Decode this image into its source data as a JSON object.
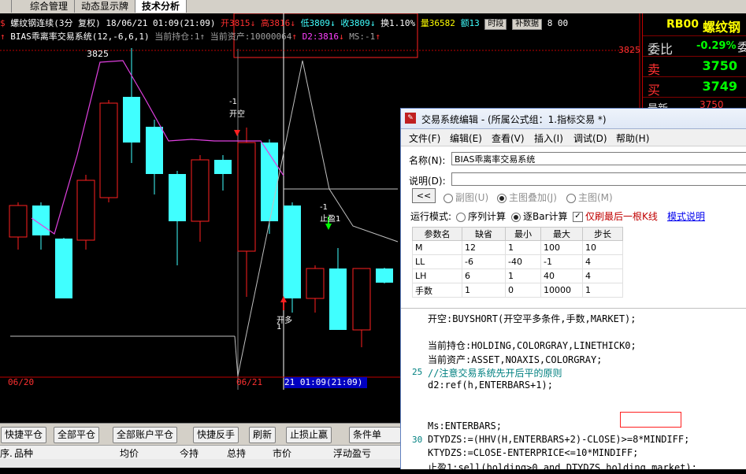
{
  "tabs": [
    {
      "label": "综合管理"
    },
    {
      "label": "动态显示牌"
    },
    {
      "label": "技术分析"
    }
  ],
  "quote_line": {
    "symbol": "螺纹钢连续(3分 复权) 18/06/21 01:09(21:09)",
    "open": "开3815",
    "high": "高3816",
    "low": "低3809",
    "close": "收3809",
    "change": "换1.10%",
    "volume": "量36582",
    "amount": "额13",
    "btn_timesection": "时段",
    "btn_fillin": "补数据",
    "tail": "8 00"
  },
  "indicator_line": {
    "name": "BIAS乖离率交易系统(12,-6,6,1)",
    "holding": "当前持仓:1",
    "asset": "当前资产:10000064",
    "d2": "D2:3816",
    "ms": "MS:-1"
  },
  "chart": {
    "high_label": "3825",
    "price_tag": "3825",
    "signal_open_short": [
      "-1",
      "开空"
    ],
    "signal_stop_gain": [
      "-1",
      "止盈1"
    ],
    "signal_close": [
      "开多",
      "1"
    ],
    "date_left": "06/20",
    "date_mid": "06/21",
    "date_cursor": "21 01:09(21:09)"
  },
  "right_panel": {
    "code": "RB00",
    "name": "螺纹钢",
    "weibi_label": "委比",
    "weibi_value": "-0.29%",
    "weibi_tail": "委",
    "sell_label": "卖",
    "sell_value": "3750",
    "buy_label": "买",
    "buy_value": "3749",
    "latest_label": "最新",
    "latest_value": "3750"
  },
  "editor": {
    "title": "交易系统编辑 - (所属公式组：1.指标交易 *)",
    "menu": [
      "文件(F)",
      "编辑(E)",
      "查看(V)",
      "插入(I)",
      "调试(D)",
      "帮助(H)"
    ],
    "name_label": "名称(N):",
    "name_value": "BIAS乖离率交易系统",
    "desc_label": "说明(D):",
    "desc_value": "",
    "collapse_btn": "<<",
    "radio_sub": "副图(U)",
    "radio_overlay": "主图叠加(J)",
    "radio_main": "主图(M)",
    "mode_label": "运行模式:",
    "mode_seq": "序列计算",
    "mode_tick": "逐Bar计算",
    "only_last": "仅刷最后一根K线",
    "model_help": "模式说明",
    "param_headers": [
      "参数名",
      "缺省",
      "最小",
      "最大",
      "步长"
    ],
    "params": [
      [
        "M",
        "12",
        "1",
        "100",
        "10"
      ],
      [
        "LL",
        "-6",
        "-40",
        "-1",
        "4"
      ],
      [
        "LH",
        "6",
        "1",
        "40",
        "4"
      ],
      [
        "手数",
        "1",
        "0",
        "10000",
        "1"
      ]
    ],
    "code_lines": [
      {
        "n": "",
        "t": "开空:BUYSHORT(开空平多条件,手数,MARKET);"
      },
      {
        "n": "",
        "t": ""
      },
      {
        "n": "",
        "t": "当前持仓:HOLDING,COLORGRAY,LINETHICK0;"
      },
      {
        "n": "",
        "t": "当前资产:ASSET,NOAXIS,COLORGRAY;"
      },
      {
        "n": "25",
        "t": "//注意交易系统先开后平的原则"
      },
      {
        "n": "",
        "t": "d2:ref(h,ENTERBARS+1);"
      },
      {
        "n": "",
        "t": ""
      },
      {
        "n": "",
        "t": ""
      },
      {
        "n": "",
        "t": "Ms:ENTERBARS;"
      },
      {
        "n": "30",
        "t": "DTYDZS:=(HHV(H,ENTERBARS+2)-CLOSE)>=8*MINDIFF;"
      },
      {
        "n": "",
        "t": "KTYDZS:=CLOSE-ENTERPRICE<=10*MINDIFF;"
      },
      {
        "n": "",
        "t": "止盈1:sell(holding>0 and DTYDZS,holding,market);"
      }
    ]
  },
  "bottom_buttons": [
    "快捷平仓",
    "全部平仓",
    "全部账户平仓",
    "快捷反手",
    "刷新",
    "止损止赢",
    "条件单"
  ],
  "table_columns": [
    "序.",
    "品种",
    "均价",
    "今持",
    "总持",
    "市价",
    "浮动盈亏"
  ],
  "colors": {
    "up_candle": "#ff2020",
    "down_candle": "#40ffff",
    "line_magenta": "#e040e0",
    "line_gray": "#c0c0c0"
  }
}
